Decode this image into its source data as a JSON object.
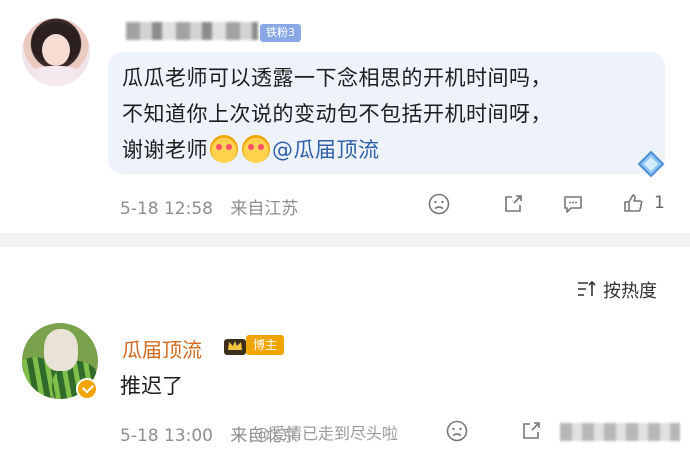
{
  "comment1": {
    "fan_badge": "铁粉3",
    "text_line1": "瓜瓜老师可以透露一下念相思的开机时间吗，",
    "text_line2": "不知道你上次说的变动包不包括开机时间呀，",
    "text_line3_prefix": "谢谢老师",
    "mention": "@瓜届顶流",
    "time": "5-18 12:58",
    "location": "来自江苏",
    "like_count": "1",
    "icons": [
      "sad-face-icon",
      "share-icon",
      "reply-icon",
      "like-icon"
    ]
  },
  "sort": {
    "label": "按热度",
    "icon": "sort-icon"
  },
  "comment2": {
    "username": "瓜届顶流",
    "role_badge": "博主",
    "text": "推迟了",
    "time": "5-18 13:00",
    "location": "来自北京",
    "icons": [
      "sad-face-icon",
      "share-icon"
    ]
  },
  "watermark": {
    "text": "@爱情已走到尽头啦"
  },
  "colors": {
    "bubble": "#eef2fb",
    "meta": "#8e8e8e",
    "mention": "#2f5fa8",
    "username2": "#d2691e",
    "blogger_badge": "#f0a500",
    "fan_badge": "#8aa8e6"
  }
}
